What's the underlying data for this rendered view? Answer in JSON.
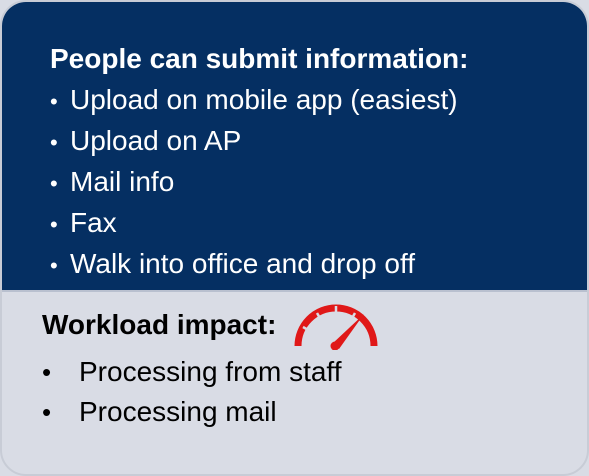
{
  "submit": {
    "title": "People can submit information:",
    "bullet": "•",
    "items": [
      "Upload on mobile app (easiest)",
      "Upload on AP",
      "Mail info",
      "Fax",
      "Walk into office and drop off"
    ]
  },
  "workload": {
    "title": "Workload impact:",
    "bullet": "•",
    "items": [
      "Processing from staff",
      "Processing mail"
    ],
    "gauge_icon": "speedometer-high-icon",
    "gauge_color": "#e01818"
  },
  "colors": {
    "panel_top": "#052f62",
    "panel_bottom": "#d9dce5"
  }
}
